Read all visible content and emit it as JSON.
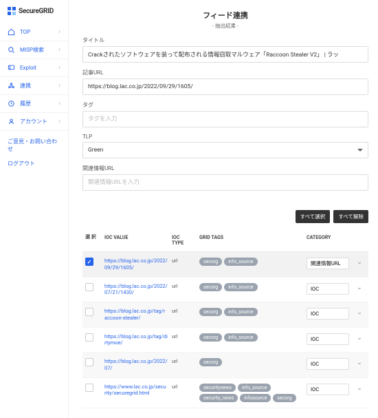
{
  "brand": "SecureGRID",
  "sidebar": {
    "items": [
      {
        "label": "TOP",
        "icon": "home"
      },
      {
        "label": "MISP検索",
        "icon": "search"
      },
      {
        "label": "Exploit",
        "icon": "flag"
      },
      {
        "label": "連携",
        "icon": "network"
      },
      {
        "label": "履歴",
        "icon": "history"
      },
      {
        "label": "アカウント",
        "icon": "user"
      }
    ],
    "feedback": "ご意見・お問い合わせ",
    "logout": "ログアウト"
  },
  "page": {
    "title": "フィード連携",
    "subtitle": "- 抽出結果 -"
  },
  "form": {
    "title_label": "タイトル",
    "title_value": "Crackされたソフトウェアを装って配布される情報窃取マルウェア「Raccoon Stealer V2」 | ラッ",
    "url_label": "記事URL",
    "url_value": "https://blog.lac.co.jp/2022/09/29/1605/",
    "tag_label": "タグ",
    "tag_placeholder": "タグを入力",
    "tlp_label": "TLP",
    "tlp_value": "Green",
    "related_label": "関連情報URL",
    "related_placeholder": "関連情報URLを入力"
  },
  "buttons": {
    "select_all": "すべて選択",
    "deselect_all": "すべて解除"
  },
  "table": {
    "headers": {
      "select": "選\n択",
      "value": "IOC VALUE",
      "type": "IOC\nTYPE",
      "tags": "GRID TAGS",
      "category": "CATEGORY"
    },
    "rows": [
      {
        "checked": true,
        "value": "https://blog.lac.co.jp/2022/09/29/1605/",
        "type": "url",
        "tags": [
          "secorg",
          "info_source"
        ],
        "category": "関連情報URL"
      },
      {
        "checked": false,
        "value": "https://blog.lac.co.jp/2022/07/21/1430/",
        "type": "url",
        "tags": [
          "secorg",
          "info_source"
        ],
        "category": "IOC"
      },
      {
        "checked": false,
        "value": "https://blog.lac.co.jp/tag/raccoon-stealer/",
        "type": "url",
        "tags": [
          "secorg",
          "info_source"
        ],
        "category": "IOC"
      },
      {
        "checked": false,
        "value": "https://blog.lac.co.jp/tag/dirtymoe/",
        "type": "url",
        "tags": [
          "secorg",
          "info_source"
        ],
        "category": "IOC"
      },
      {
        "checked": false,
        "value": "https://blog.lac.co.jp/2022/07/",
        "type": "url",
        "tags": [
          "secorg"
        ],
        "category": "IOC"
      },
      {
        "checked": false,
        "value": "https://www.lac.co.jp/security/securegrid.html",
        "type": "url",
        "tags": [
          "securitynews",
          "info_source",
          "security_news",
          "infosource",
          "secorg"
        ],
        "category": "IOC"
      }
    ]
  }
}
